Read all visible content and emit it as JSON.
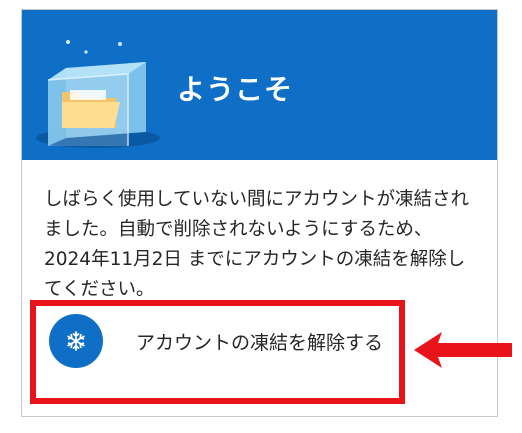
{
  "banner": {
    "title": "ようこそ"
  },
  "message": {
    "text": "しばらく使用していない間にアカウントが凍結されました。自動で削除されないようにするため、2024年11月2日 までにアカウントの凍結を解除してください。"
  },
  "action": {
    "label": "アカウントの凍結を解除する",
    "icon": "snowflake-icon"
  },
  "annotations": {
    "highlight_color": "#e8141a",
    "arrow_color": "#e8141a"
  },
  "colors": {
    "brand_blue": "#0f6fc6"
  }
}
